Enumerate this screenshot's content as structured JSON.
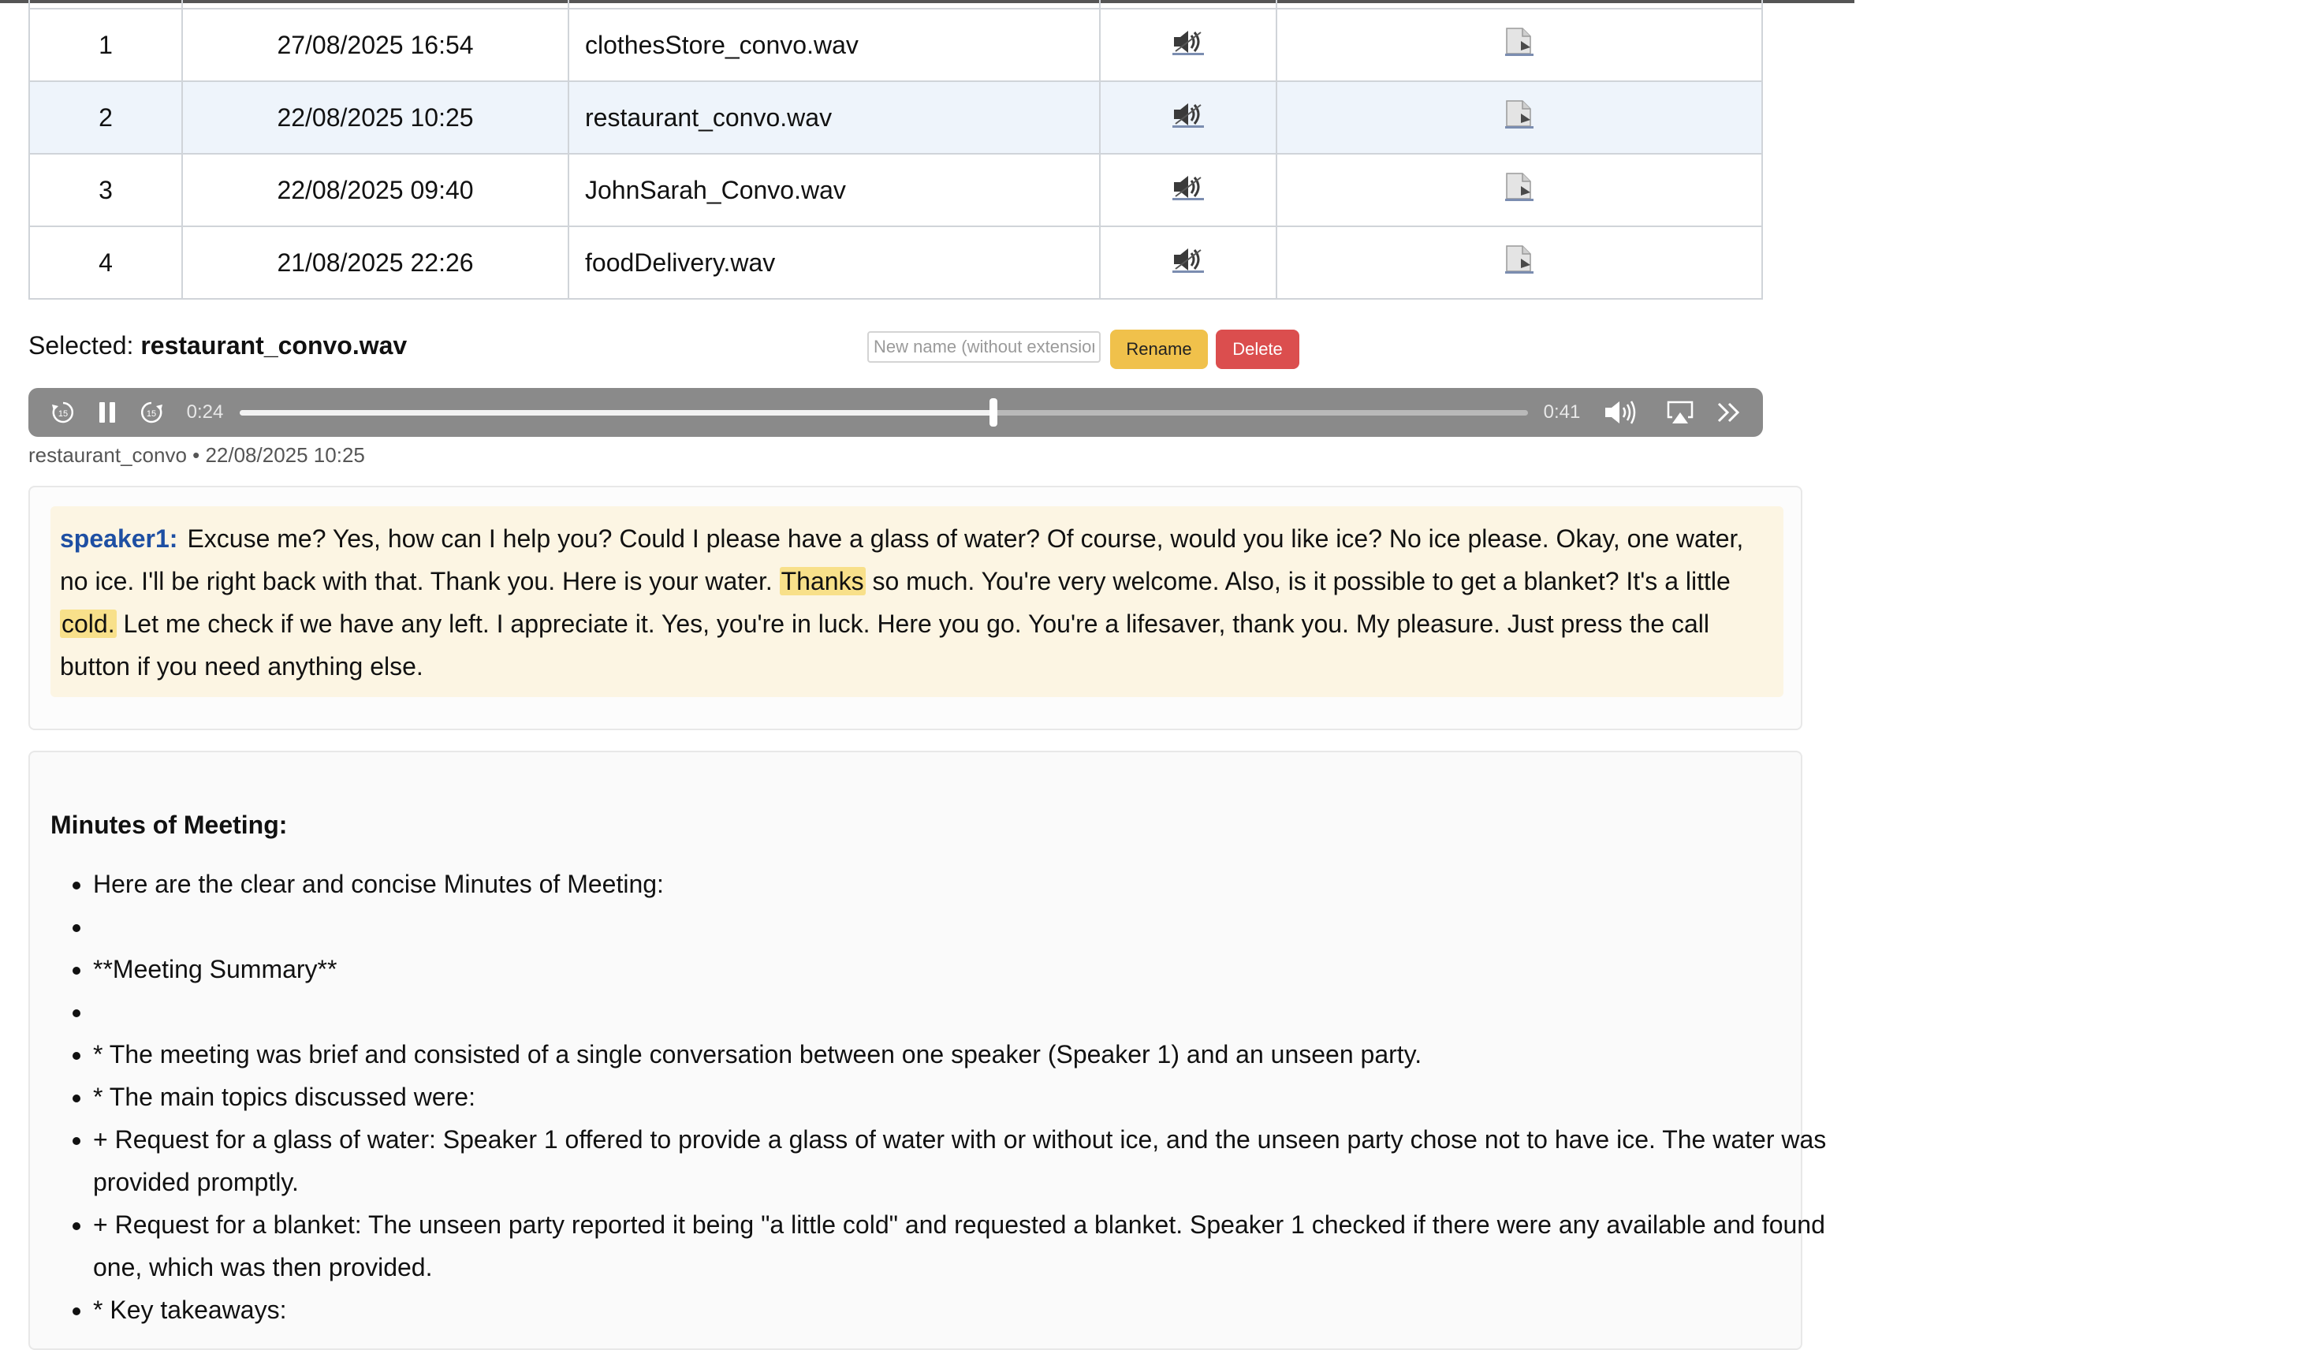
{
  "recordings": [
    {
      "num": "1",
      "datetime": "27/08/2025 16:54",
      "file": "clothesStore_convo.wav",
      "selected": false
    },
    {
      "num": "2",
      "datetime": "22/08/2025 10:25",
      "file": "restaurant_convo.wav",
      "selected": true
    },
    {
      "num": "3",
      "datetime": "22/08/2025 09:40",
      "file": "JohnSarah_Convo.wav",
      "selected": false
    },
    {
      "num": "4",
      "datetime": "21/08/2025 22:26",
      "file": "foodDelivery.wav",
      "selected": false
    }
  ],
  "row_icons": {
    "play": "speaker-icon",
    "doc": "document-icon"
  },
  "selection": {
    "label": "Selected:",
    "file": "restaurant_convo.wav",
    "rename_placeholder": "New name (without extension)",
    "rename_label": "Rename",
    "delete_label": "Delete"
  },
  "player": {
    "current_time": "0:24",
    "duration": "0:41",
    "progress": 0.585,
    "state": "playing",
    "caption": "restaurant_convo • 22/08/2025 10:25"
  },
  "transcript": {
    "speaker": "speaker1:",
    "segments": [
      {
        "text": "Excuse me? Yes, how can I help you? Could I please have a glass of water? Of course, would you like ice? No ice please. Okay, one water, no ice. I'll be right back with that. Thank you. Here is your water. ",
        "highlight": false
      },
      {
        "text": "Thanks",
        "highlight": true
      },
      {
        "text": " so much. You're very welcome. Also, is it possible to get a blanket? It's a little ",
        "highlight": false
      },
      {
        "text": "cold.",
        "highlight": true
      },
      {
        "text": " Let me check if we have any left. I appreciate it. Yes, you're in luck. Here you go. You're a lifesaver, thank you. My pleasure. Just press the call button if you need anything else.",
        "highlight": false
      }
    ]
  },
  "minutes": {
    "title": "Minutes of Meeting:",
    "items": [
      "Here are the clear and concise Minutes of Meeting:",
      "",
      "**Meeting Summary**",
      "",
      "* The meeting was brief and consisted of a single conversation between one speaker (Speaker 1) and an unseen party.",
      "* The main topics discussed were:",
      "+ Request for a glass of water: Speaker 1 offered to provide a glass of water with or without ice, and the unseen party chose not to have ice. The water was provided promptly.",
      "+ Request for a blanket: The unseen party reported it being \"a little cold\" and requested a blanket. Speaker 1 checked if there were any available and found one, which was then provided.",
      "* Key takeaways:"
    ]
  },
  "colors": {
    "accent_speaker": "#1e4fa3",
    "highlight": "#f8e08a",
    "rename_button": "#f0c14b",
    "delete_button": "#db4e4e",
    "selected_row": "#eef4fb",
    "player_bg": "#8a8a8a"
  }
}
